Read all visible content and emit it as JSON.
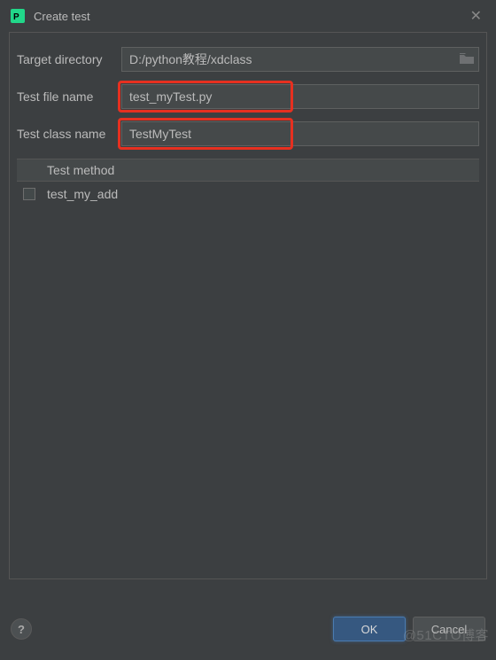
{
  "dialog": {
    "title": "Create test"
  },
  "form": {
    "target_directory_label": "Target directory",
    "target_directory_value": "D:/python教程/xdclass",
    "test_file_name_label": "Test file name",
    "test_file_name_value": "test_myTest.py",
    "test_class_name_label": "Test class name",
    "test_class_name_value": "TestMyTest"
  },
  "table": {
    "header": "Test method",
    "rows": [
      {
        "name": "test_my_add",
        "checked": false
      }
    ]
  },
  "buttons": {
    "help": "?",
    "ok": "OK",
    "cancel": "Cancel"
  },
  "watermark": "@51CTO博客"
}
